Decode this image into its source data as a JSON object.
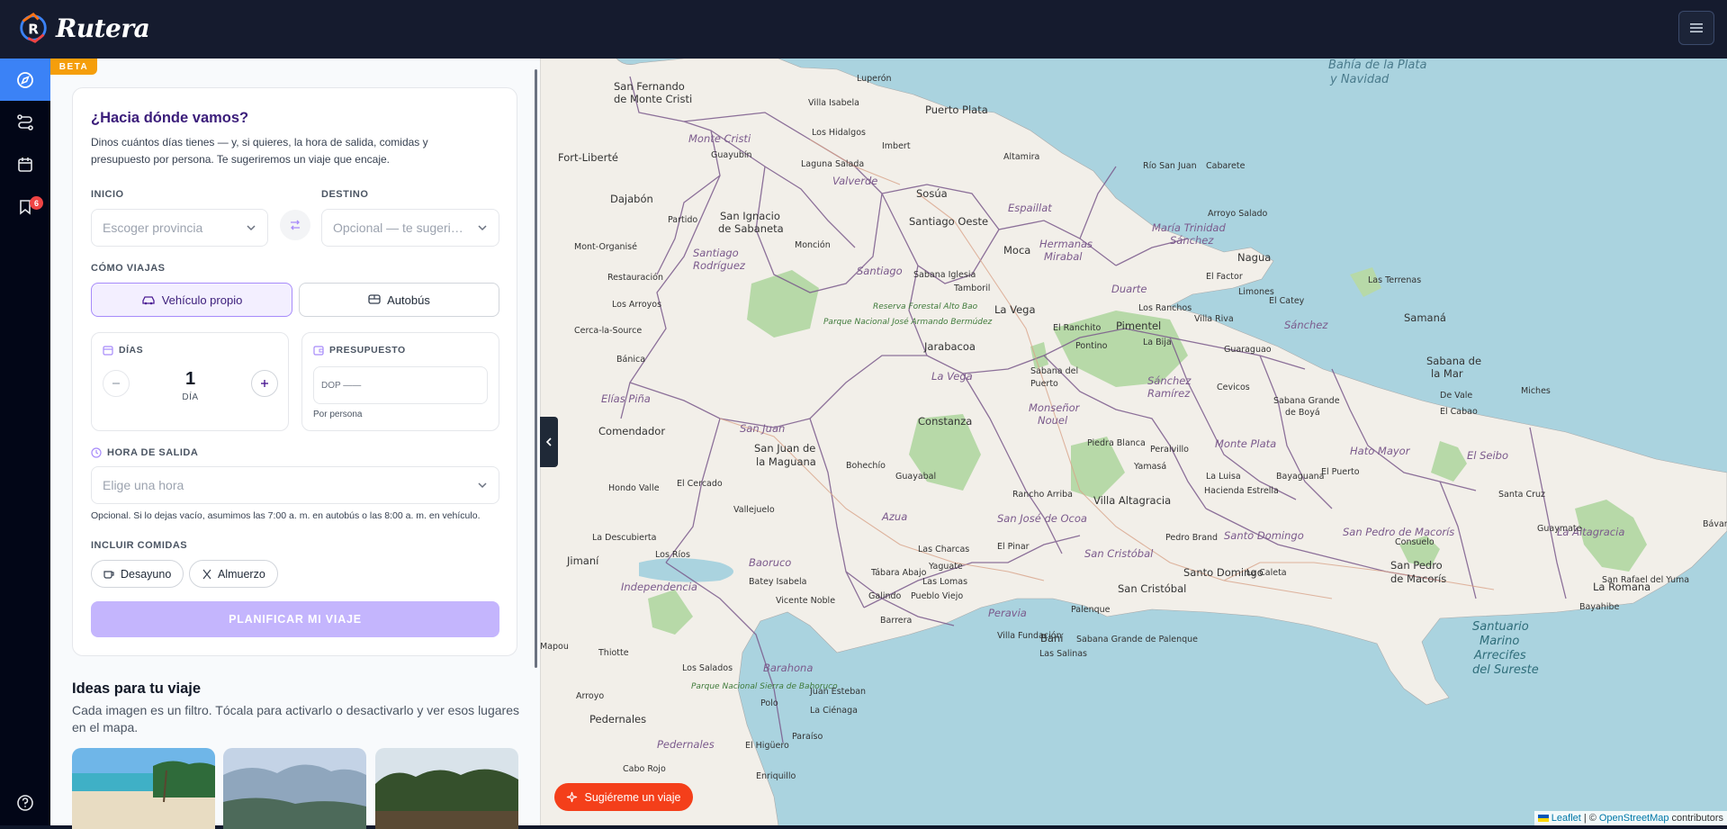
{
  "app": {
    "name": "Rutera",
    "beta_label": "BETA"
  },
  "rail": {
    "badge_count": "6"
  },
  "planner": {
    "title": "¿Hacia dónde vamos?",
    "description": "Dinos cuántos días tienes — y, si quieres, la hora de salida, comidas y presupuesto por persona. Te sugeriremos un viaje que encaje.",
    "origin_label": "INICIO",
    "origin_placeholder": "Escoger provincia",
    "destination_label": "DESTINO",
    "destination_placeholder": "Opcional — te sugeri…",
    "mode_label": "CÓMO VIAJAS",
    "mode_car": "Vehículo propio",
    "mode_bus": "Autobús",
    "days_label": "DÍAS",
    "days_value": "1",
    "days_unit": "DÍA",
    "budget_label": "PRESUPUESTO",
    "budget_placeholder": "DOP ——",
    "budget_note": "Por persona",
    "departure_label": "HORA DE SALIDA",
    "departure_placeholder": "Elige una hora",
    "departure_hint": "Opcional. Si lo dejas vacío, asumimos las 7:00 a. m. en autobús o las 8:00 a. m. en vehículo.",
    "meals_label": "INCLUIR COMIDAS",
    "meal_breakfast": "Desayuno",
    "meal_lunch": "Almuerzo",
    "submit": "PLANIFICAR MI VIAJE"
  },
  "ideas": {
    "title": "Ideas para tu viaje",
    "description": "Cada imagen es un filtro. Tócala para activarlo o desactivarlo y ver esos lugares en el mapa."
  },
  "map": {
    "suggest_button": "Sugiéreme un viaje",
    "attribution_leaflet": "Leaflet",
    "attribution_sep": "| ©",
    "attribution_osm": "OpenStreetMap",
    "attribution_tail": "contributors",
    "labels": {
      "l1": "Bahía de la Plata",
      "l2": "y Navidad",
      "l3": "Luperón",
      "l4": "Villa Isabela",
      "l5": "Puerto Plata",
      "l6": "Sosúa",
      "l7": "Cabarete",
      "l8": "Río San Juan",
      "l9": "San Fernando",
      "l10": "de Monte Cristi",
      "l11": "Monte Cristi",
      "l12": "Guayubín",
      "l13": "Laguna Salada",
      "l14": "Los Hidalgos",
      "l15": "Imbert",
      "l16": "Altamira",
      "l17": "Fort-Liberté",
      "l18": "Dajabón",
      "l19": "Partido",
      "l20": "San Ignacio",
      "l21": "de Sabaneta",
      "l22": "Valverde",
      "l23": "Santiago Oeste",
      "l24": "Espaillat",
      "l25": "Moca",
      "l26": "Arroyo Salado",
      "l27": "Nagua",
      "l28": "Mont-Organisé",
      "l29": "Santiago",
      "l30": "Rodríguez",
      "l31": "Monción",
      "l32": "Santiago",
      "l33": "Sabana Iglesia",
      "l34": "Tamboril",
      "l35": "Hermanas",
      "l36": "Mirabal",
      "l37": "María Trinidad",
      "l38": "Sánchez",
      "l39": "El Factor",
      "l40": "Limones",
      "l41": "Las Terrenas",
      "l42": "Restauración",
      "l43": "Los Arroyos",
      "l44": "La Vega",
      "l45": "Duarte",
      "l46": "Los Ranchos",
      "l47": "El Catey",
      "l48": "Samaná",
      "l49": "Cerca-la-Source",
      "l50": "Jarabacoa",
      "l51": "El Ranchito",
      "l52": "Pimentel",
      "l53": "Villa Riva",
      "l54": "Sánchez",
      "l55": "Bánica",
      "l56": "Reserva Forestal Alto Bao",
      "l57": "Parque Nacional José Armando Bermúdez",
      "l58": "Pontino",
      "l59": "La Bija",
      "l60": "Guaraguao",
      "l61": "Sabana de",
      "l62": "la Mar",
      "l63": "Elías Piña",
      "l64": "La Vega",
      "l65": "Sabana del",
      "l66": "Puerto",
      "l67": "Sánchez",
      "l68": "Ramírez",
      "l69": "Cevicos",
      "l70": "Sabana Grande",
      "l71": "de Boyá",
      "l72": "Miches",
      "l73": "De Vale",
      "l74": "El Cabao",
      "l75": "Comendador",
      "l76": "San Juan",
      "l77": "Constanza",
      "l78": "Monseñor",
      "l79": "Nouel",
      "l80": "Piedra Blanca",
      "l81": "Monte Plata",
      "l82": "San Juan de",
      "l83": "la Maguana",
      "l84": "Bohechío",
      "l85": "Guayabal",
      "l86": "Peralvillo",
      "l87": "Yamasá",
      "l88": "La Luisa",
      "l89": "Bayaguana",
      "l90": "Hato Mayor",
      "l91": "El Seibo",
      "l92": "Hondo Valle",
      "l93": "El Cercado",
      "l94": "Rancho Arriba",
      "l95": "Villa Altagracia",
      "l96": "Hacienda Estrella",
      "l97": "El Puerto",
      "l98": "Vallejuelo",
      "l99": "Azua",
      "l100": "San José de Ocoa",
      "l101": "Pedro Brand",
      "l102": "Santo Domingo",
      "l103": "San Pedro de Macorís",
      "l104": "La Altagracia",
      "l105": "Santa Cruz",
      "l106": "La Descubierta",
      "l107": "Las Charcas",
      "l108": "El Pinar",
      "l109": "Las Lomas",
      "l110": "San Cristóbal",
      "l111": "Consuelo",
      "l112": "Guaymate",
      "l113": "Jimaní",
      "l114": "Los Ríos",
      "l115": "Baoruco",
      "l116": "Tábara Abajo",
      "l117": "Yaguate",
      "l118": "Santo Domingo",
      "l119": "La Caleta",
      "l120": "San Pedro",
      "l121": "de Macorís",
      "l122": "La Romana",
      "l123": "San Rafael del Yuma",
      "l124": "Independencia",
      "l125": "Batey Isabela",
      "l126": "Vicente Noble",
      "l127": "Galindo",
      "l128": "Pueblo Viejo",
      "l129": "Palenque",
      "l130": "San Cristóbal",
      "l131": "Bayahibe",
      "l132": "Peravia",
      "l133": "Barrera",
      "l134": "Villa Fundación",
      "l135": "Baní",
      "l136": "Sabana Grande de Palenque",
      "l137": "Mapou",
      "l138": "Thiotte",
      "l139": "Los Salados",
      "l140": "Parque Nacional Sierra de Bahoruco",
      "l141": "Barahona",
      "l142": "Arroyo",
      "l143": "Pedernales",
      "l144": "Polo",
      "l145": "Juan Esteban",
      "l146": "La Ciénaga",
      "l147": "Paraíso",
      "l148": "Pedernales",
      "l149": "El Higüero",
      "l150": "Enriquillo",
      "l151": "Cabo Rojo",
      "l152": "Santuario",
      "l153": "Marino",
      "l154": "Arrecifes",
      "l155": "del Sureste",
      "l156": "Bávaro",
      "l157": "Las Salinas",
      "l158": "Baní"
    }
  },
  "colors": {
    "accent": "#3b82f6",
    "primary": "#7c3aed",
    "cta": "#f43f1a",
    "beta": "#f59e0b",
    "sea": "#aad3df",
    "land": "#f2efe9"
  }
}
